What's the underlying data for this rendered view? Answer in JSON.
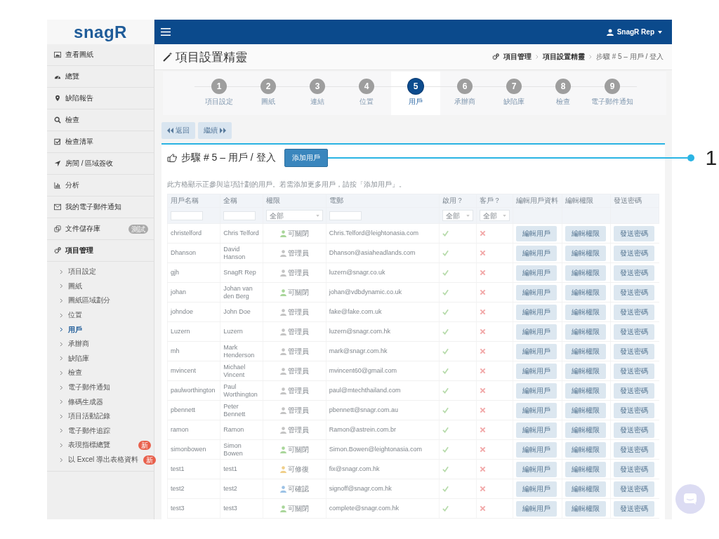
{
  "logo": {
    "text": "snagR"
  },
  "topbar": {
    "user": "SnagR Rep"
  },
  "sidebar": {
    "items": [
      {
        "label": "查看圖紙",
        "selected": false
      },
      {
        "label": "總覽",
        "selected": false
      },
      {
        "label": "缺陷報告",
        "selected": false
      },
      {
        "label": "檢查",
        "selected": false
      },
      {
        "label": "檢查清單",
        "selected": false
      },
      {
        "label": "房間 / 區域簽收",
        "selected": false
      },
      {
        "label": "分析",
        "selected": false
      },
      {
        "label": "我的電子郵件通知",
        "selected": false
      },
      {
        "label": "文件儲存庫",
        "selected": false,
        "badge": "測試"
      },
      {
        "label": "項目管理",
        "selected": true,
        "expanded": true,
        "children": [
          {
            "label": "項目設定",
            "selected": false
          },
          {
            "label": "圖紙",
            "selected": false
          },
          {
            "label": "圖紙區域劃分",
            "selected": false
          },
          {
            "label": "位置",
            "selected": false
          },
          {
            "label": "用戶",
            "selected": true
          },
          {
            "label": "承辦商",
            "selected": false
          },
          {
            "label": "缺陷庫",
            "selected": false
          },
          {
            "label": "檢查",
            "selected": false
          },
          {
            "label": "電子郵件通知",
            "selected": false
          },
          {
            "label": "條碼生成器",
            "selected": false
          },
          {
            "label": "項目活動記錄",
            "selected": false
          },
          {
            "label": "電子郵件追踪",
            "selected": false
          },
          {
            "label": "表現指標總覽",
            "selected": false,
            "badge": "新"
          },
          {
            "label": "以 Excel 導出表格資料",
            "selected": false,
            "badge": "新"
          }
        ]
      }
    ]
  },
  "page": {
    "title": "項目設置精靈",
    "breadcrumb": [
      "項目管理",
      "項目設置精靈",
      "步驟 # 5 – 用戶 / 登入"
    ]
  },
  "wizard": {
    "steps": [
      {
        "number": "1",
        "label": "項目設定",
        "selected": false
      },
      {
        "number": "2",
        "label": "圖紙",
        "selected": false
      },
      {
        "number": "3",
        "label": "連結",
        "selected": false
      },
      {
        "number": "4",
        "label": "位置",
        "selected": false
      },
      {
        "number": "5",
        "label": "用戶",
        "selected": true
      },
      {
        "number": "6",
        "label": "承辦商",
        "selected": false
      },
      {
        "number": "7",
        "label": "缺陷庫",
        "selected": false
      },
      {
        "number": "8",
        "label": "檢查",
        "selected": false
      },
      {
        "number": "9",
        "label": "電子郵件通知",
        "selected": false
      }
    ]
  },
  "nav_buttons": [
    {
      "label": "返回"
    },
    {
      "label": "繼續"
    }
  ],
  "panel": {
    "title": "步驟 # 5 – 用戶 / 登入",
    "add_button": "添加用戶",
    "info": "此方格顯示正參與這項計劃的用戶。若需添加更多用戶，請按「添加用戶」。"
  },
  "table": {
    "columns": [
      "用戶名稱",
      "全稱",
      "權限",
      "電郵",
      "啟用？",
      "客戶？",
      "編輯用戶資料",
      "編輯權限",
      "發送密碼"
    ],
    "filters": {
      "role": "全部",
      "enabled": "全部",
      "client": "全部"
    },
    "rows": [
      {
        "username": "christelford",
        "full_name": "Chris Telford",
        "role": {
          "label": "可關閉",
          "color": "#a9d69a"
        },
        "email": "Chris.Telford@leightonasia.com",
        "enabled": true,
        "client": false,
        "actions": [
          "編輯用戶",
          "編輯權限",
          "發送密碼"
        ]
      },
      {
        "username": "Dhanson",
        "full_name": "David Hanson",
        "role": {
          "label": "管理員",
          "color": "#c4c4c4"
        },
        "email": "Dhanson@asiaheadlands.com",
        "enabled": true,
        "client": false,
        "actions": [
          "編輯用戶",
          "編輯權限",
          "發送密碼"
        ]
      },
      {
        "username": "gjh",
        "full_name": "SnagR Rep",
        "role": {
          "label": "管理員",
          "color": "#c4c4c4"
        },
        "email": "luzern@snagr.co.uk",
        "enabled": true,
        "client": false,
        "actions": [
          "編輯用戶",
          "編輯權限",
          "發送密碼"
        ]
      },
      {
        "username": "johan",
        "full_name": "Johan van den Berg",
        "role": {
          "label": "可關閉",
          "color": "#a9d69a"
        },
        "email": "johan@vdbdynamic.co.uk",
        "enabled": true,
        "client": false,
        "actions": [
          "編輯用戶",
          "編輯權限",
          "發送密碼"
        ]
      },
      {
        "username": "johndoe",
        "full_name": "John Doe",
        "role": {
          "label": "管理員",
          "color": "#c4c4c4"
        },
        "email": "fake@fake.com.uk",
        "enabled": true,
        "client": false,
        "actions": [
          "編輯用戶",
          "編輯權限",
          "發送密碼"
        ]
      },
      {
        "username": "Luzern",
        "full_name": "Luzern",
        "role": {
          "label": "管理員",
          "color": "#c4c4c4"
        },
        "email": "luzern@snagr.com.hk",
        "enabled": true,
        "client": false,
        "actions": [
          "編輯用戶",
          "編輯權限",
          "發送密碼"
        ]
      },
      {
        "username": "mh",
        "full_name": "Mark Henderson",
        "role": {
          "label": "管理員",
          "color": "#c4c4c4"
        },
        "email": "mark@snagr.com.hk",
        "enabled": true,
        "client": false,
        "actions": [
          "編輯用戶",
          "編輯權限",
          "發送密碼"
        ]
      },
      {
        "username": "mvincent",
        "full_name": "Michael Vincent",
        "role": {
          "label": "管理員",
          "color": "#c4c4c4"
        },
        "email": "mvincent60@gmail.com",
        "enabled": true,
        "client": false,
        "actions": [
          "編輯用戶",
          "編輯權限",
          "發送密碼"
        ]
      },
      {
        "username": "paulworthington",
        "full_name": "Paul Worthington",
        "role": {
          "label": "管理員",
          "color": "#c4c4c4"
        },
        "email": "paul@mtechthailand.com",
        "enabled": true,
        "client": false,
        "actions": [
          "編輯用戶",
          "編輯權限",
          "發送密碼"
        ]
      },
      {
        "username": "pbennett",
        "full_name": "Peter Bennett",
        "role": {
          "label": "管理員",
          "color": "#c4c4c4"
        },
        "email": "pbennett@snagr.com.au",
        "enabled": true,
        "client": false,
        "actions": [
          "編輯用戶",
          "編輯權限",
          "發送密碼"
        ]
      },
      {
        "username": "ramon",
        "full_name": "Ramon",
        "role": {
          "label": "管理員",
          "color": "#c4c4c4"
        },
        "email": "Ramon@astrein.com.br",
        "enabled": true,
        "client": false,
        "actions": [
          "編輯用戶",
          "編輯權限",
          "發送密碼"
        ]
      },
      {
        "username": "simonbowen",
        "full_name": "Simon Bowen",
        "role": {
          "label": "可關閉",
          "color": "#a9d69a"
        },
        "email": "Simon.Bowen@leightonasia.com",
        "enabled": true,
        "client": false,
        "actions": [
          "編輯用戶",
          "編輯權限",
          "發送密碼"
        ]
      },
      {
        "username": "test1",
        "full_name": "test1",
        "role": {
          "label": "可修復",
          "color": "#f0cf8a"
        },
        "email": "fix@snagr.com.hk",
        "enabled": true,
        "client": false,
        "actions": [
          "編輯用戶",
          "編輯權限",
          "發送密碼"
        ]
      },
      {
        "username": "test2",
        "full_name": "test2",
        "role": {
          "label": "可確認",
          "color": "#9cc2e6"
        },
        "email": "signoff@snagr.com.hk",
        "enabled": true,
        "client": false,
        "actions": [
          "編輯用戶",
          "編輯權限",
          "發送密碼"
        ]
      },
      {
        "username": "test3",
        "full_name": "test3",
        "role": {
          "label": "可關閉",
          "color": "#a9d69a"
        },
        "email": "complete@snagr.com.hk",
        "enabled": true,
        "client": false,
        "actions": [
          "編輯用戶",
          "編輯權限",
          "發送密碼"
        ]
      }
    ]
  },
  "annotation": {
    "label": "1"
  }
}
